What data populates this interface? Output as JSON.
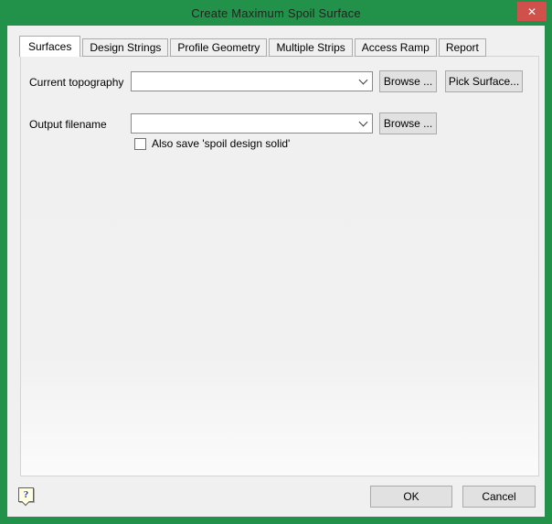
{
  "window": {
    "title": "Create Maximum Spoil Surface",
    "close_glyph": "✕"
  },
  "colors": {
    "frame_green": "#22924a",
    "close_red": "#d0504b",
    "dialog_bg": "#f0f0f0",
    "active_tab_bg": "#ffffff",
    "tab_border": "#acacac",
    "button_bg": "#e1e1e1",
    "help_bubble_bg": "#ffffe1",
    "help_question_blue": "#2430c8"
  },
  "tabs": [
    {
      "label": "Surfaces",
      "active": true
    },
    {
      "label": "Design Strings",
      "active": false
    },
    {
      "label": "Profile Geometry",
      "active": false
    },
    {
      "label": "Multiple Strips",
      "active": false
    },
    {
      "label": "Access Ramp",
      "active": false
    },
    {
      "label": "Report",
      "active": false
    }
  ],
  "form": {
    "current_topography": {
      "label": "Current topography",
      "value": "",
      "browse_label": "Browse ...",
      "pick_surface_label": "Pick Surface..."
    },
    "output_filename": {
      "label": "Output filename",
      "value": "",
      "browse_label": "Browse ..."
    },
    "also_save": {
      "label": "Also save 'spoil design solid'",
      "checked": false
    }
  },
  "footer": {
    "ok_label": "OK",
    "cancel_label": "Cancel",
    "help_glyph": "?"
  }
}
